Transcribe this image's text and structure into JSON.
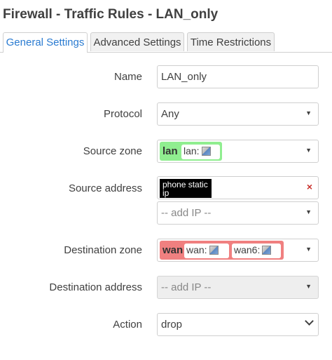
{
  "page": {
    "title": "Firewall - Traffic Rules - LAN_only"
  },
  "tabs": [
    {
      "label": "General Settings"
    },
    {
      "label": "Advanced Settings"
    },
    {
      "label": "Time Restrictions"
    }
  ],
  "form": {
    "name": {
      "label": "Name",
      "value": "LAN_only"
    },
    "protocol": {
      "label": "Protocol",
      "value": "Any"
    },
    "source_zone": {
      "label": "Source zone",
      "zone": "lan",
      "interface_label": "lan:",
      "color": "#90ee90"
    },
    "source_address": {
      "label": "Source address",
      "tag": "phone static ip",
      "add_placeholder": "-- add IP --"
    },
    "destination_zone": {
      "label": "Destination zone",
      "zone": "wan",
      "interfaces": [
        "wan:",
        "wan6:"
      ],
      "color": "#f08080"
    },
    "destination_address": {
      "label": "Destination address",
      "placeholder": "-- add IP --"
    },
    "action": {
      "label": "Action",
      "value": "drop"
    }
  },
  "icons": {
    "caret": "caret-down-icon",
    "network": "network-interface-icon",
    "remove": "remove-icon"
  },
  "glyphs": {
    "caret": "▼",
    "remove": "×"
  }
}
